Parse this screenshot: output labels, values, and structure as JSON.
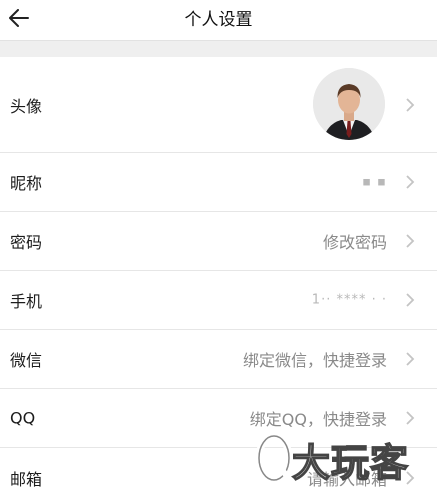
{
  "header": {
    "title": "个人设置",
    "back_icon": "back-arrow-icon"
  },
  "rows": [
    {
      "label": "头像",
      "value": "",
      "icon": "avatar"
    },
    {
      "label": "昵称",
      "value": "▪  ▪"
    },
    {
      "label": "密码",
      "value": "修改密码"
    },
    {
      "label": "手机",
      "value": "1··  ****  ·  ·"
    },
    {
      "label": "微信",
      "value": "绑定微信，快捷登录"
    },
    {
      "label": "QQ",
      "value": "绑定QQ，快捷登录"
    },
    {
      "label": "邮箱",
      "value": "请输入邮箱"
    }
  ],
  "watermark": {
    "text": "大玩客"
  },
  "colors": {
    "divider": "#e6e6e6",
    "gap_background": "#efefef",
    "secondary_text": "#8a8a8a",
    "chevron": "#c4c4c4"
  }
}
